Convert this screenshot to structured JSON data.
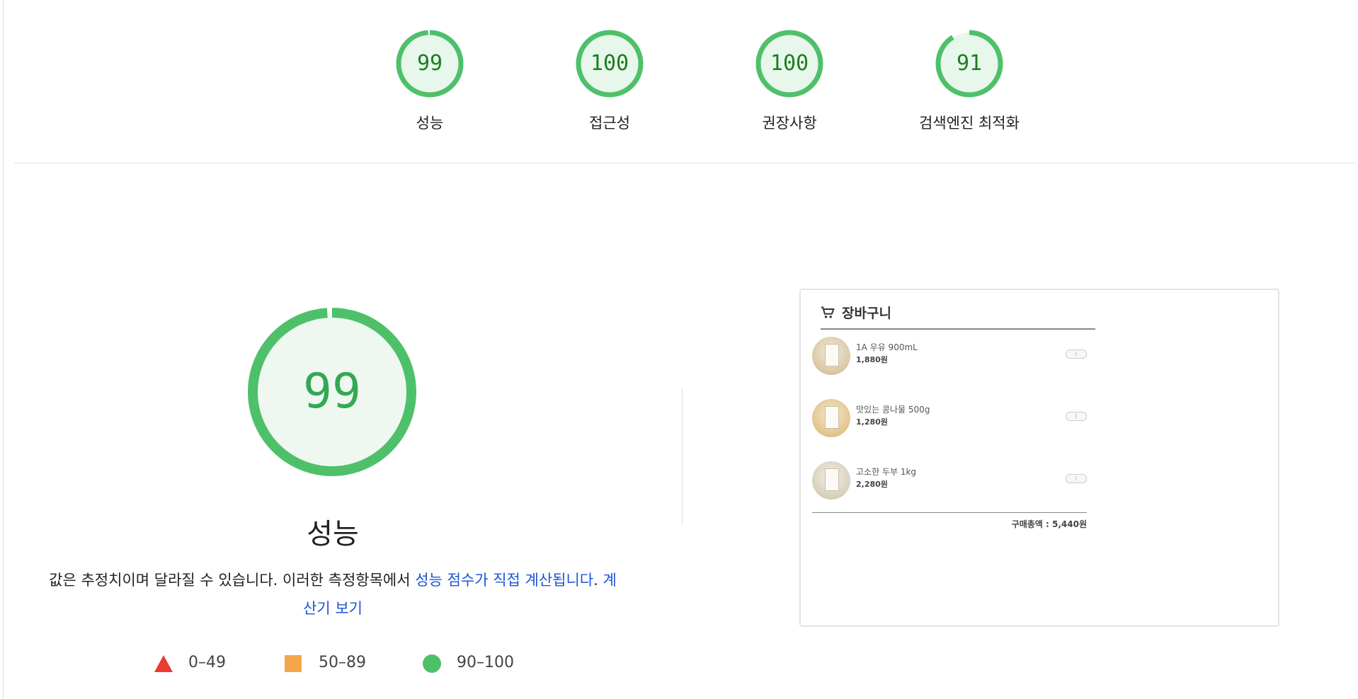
{
  "gauges": [
    {
      "score": "99",
      "label": "성능",
      "value": 99
    },
    {
      "score": "100",
      "label": "접근성",
      "value": 100
    },
    {
      "score": "100",
      "label": "권장사항",
      "value": 100
    },
    {
      "score": "91",
      "label": "검색엔진 최적화",
      "value": 91
    }
  ],
  "performance": {
    "score": "99",
    "value": 99,
    "title": "성능",
    "desc_text": "값은 추정치이며 달라질 수 있습니다. 이러한 측정항목에서 ",
    "desc_link1": "성능 점수가 직접 계산됩니다",
    "desc_middle": ". ",
    "desc_link2": "계산기 보기"
  },
  "legend": [
    {
      "range": "0–49",
      "shape": "triangle",
      "color": "#eb3b2f"
    },
    {
      "range": "50–89",
      "shape": "square",
      "color": "#f4a64a"
    },
    {
      "range": "90–100",
      "shape": "circle",
      "color": "#4fc06a"
    }
  ],
  "colors": {
    "pass": "#0cce6b",
    "pass_text": "#1a7f1f",
    "pass_bg": "#e8f7ec",
    "link": "#1a55d8"
  },
  "screenshot": {
    "cart_title": "장바구니",
    "cart_icon": "shopping-cart-icon",
    "items": [
      {
        "name": "1A 우유 900mL",
        "price": "1,880원"
      },
      {
        "name": "맛있는 콩나물 500g",
        "price": "1,280원"
      },
      {
        "name": "고소한 두부 1kg",
        "price": "2,280원"
      }
    ],
    "total": "구매총액 : 5,440원"
  }
}
